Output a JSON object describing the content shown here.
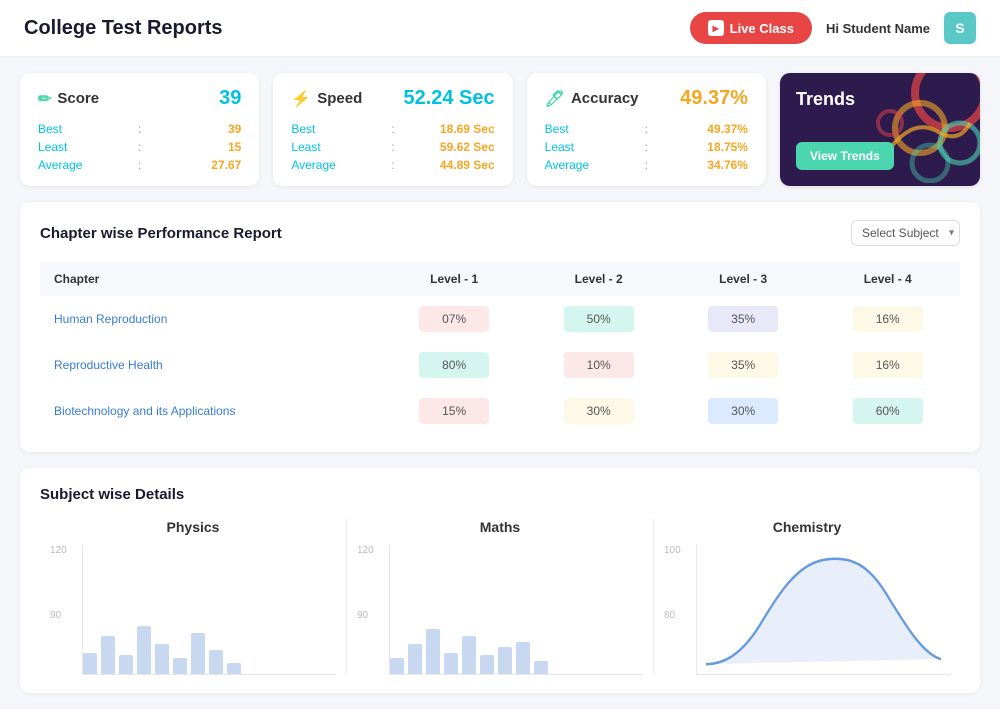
{
  "header": {
    "title": "College Test Reports",
    "live_class_label": "Live Class",
    "student_greeting": "Hi",
    "student_name": "Student Name",
    "avatar_initial": "S"
  },
  "stats": {
    "score": {
      "label": "Score",
      "icon": "✏️",
      "value": "39",
      "rows": [
        {
          "label": "Best",
          "colon": ":",
          "value": "39"
        },
        {
          "label": "Least",
          "colon": ":",
          "value": "15"
        },
        {
          "label": "Average",
          "colon": ":",
          "value": "27.67"
        }
      ]
    },
    "speed": {
      "label": "Speed",
      "icon": "⚡",
      "value": "52.24 Sec",
      "rows": [
        {
          "label": "Best",
          "colon": ":",
          "value": "18.69 Sec"
        },
        {
          "label": "Least",
          "colon": ":",
          "value": "59.62 Sec"
        },
        {
          "label": "Average",
          "colon": ":",
          "value": "44.89 Sec"
        }
      ]
    },
    "accuracy": {
      "label": "Accuracy",
      "icon": "🖊️",
      "value": "49.37%",
      "rows": [
        {
          "label": "Best",
          "colon": ":",
          "value": "49.37%"
        },
        {
          "label": "Least",
          "colon": ":",
          "value": "18.75%"
        },
        {
          "label": "Average",
          "colon": ":",
          "value": "34.76%"
        }
      ]
    }
  },
  "trends": {
    "title": "Trends",
    "button_label": "View Trends"
  },
  "performance": {
    "title": "Chapter wise Performance Report",
    "select_label": "Select Subject",
    "columns": [
      "Chapter",
      "Level - 1",
      "Level - 2",
      "Level - 3",
      "Level - 4"
    ],
    "rows": [
      {
        "chapter": "Human Reproduction",
        "l1": "07%",
        "l1_style": "pink",
        "l2": "50%",
        "l2_style": "teal",
        "l3": "35%",
        "l3_style": "lavender",
        "l4": "16%",
        "l4_style": "yellow"
      },
      {
        "chapter": "Reproductive Health",
        "l1": "80%",
        "l1_style": "teal",
        "l2": "10%",
        "l2_style": "pink",
        "l3": "35%",
        "l3_style": "yellow",
        "l4": "16%",
        "l4_style": "yellow"
      },
      {
        "chapter": "Biotechnology and its Applications",
        "l1": "15%",
        "l1_style": "pink",
        "l2": "30%",
        "l2_style": "yellow",
        "l3": "30%",
        "l3_style": "blue",
        "l4": "60%",
        "l4_style": "teal"
      }
    ]
  },
  "subject_details": {
    "title": "Subject wise Details",
    "subjects": [
      {
        "name": "Physics",
        "y_labels": [
          "120",
          "90"
        ],
        "bars": [
          20,
          35,
          18,
          45,
          28,
          15,
          38,
          22,
          10
        ]
      },
      {
        "name": "Maths",
        "y_labels": [
          "120",
          "90"
        ],
        "bars": [
          15,
          28,
          42,
          20,
          35,
          18,
          25,
          30,
          12
        ]
      },
      {
        "name": "Chemistry",
        "y_labels": [
          "100",
          "80"
        ],
        "has_curve": true
      }
    ]
  }
}
